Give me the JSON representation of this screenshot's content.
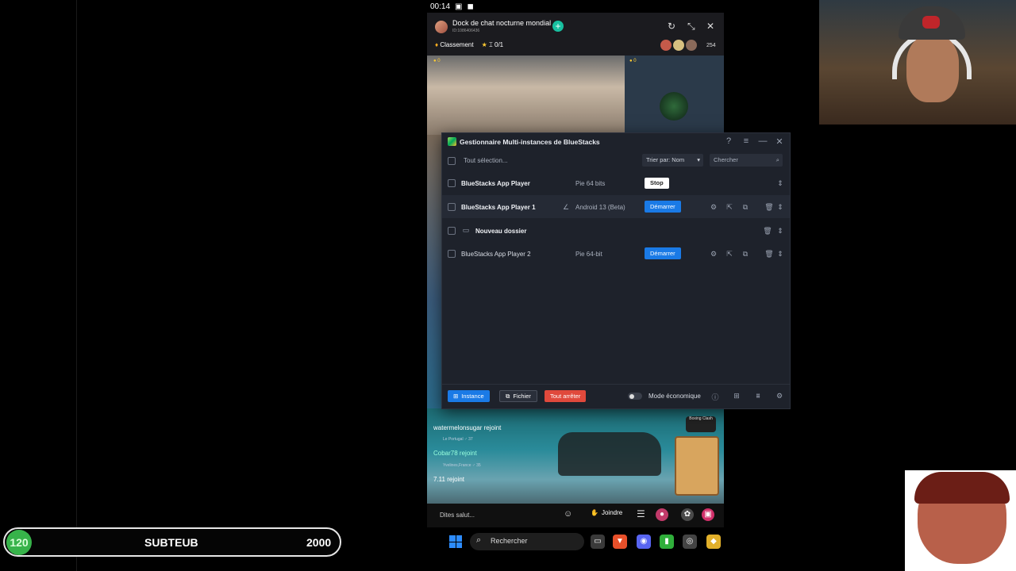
{
  "phone": {
    "time": "00:14",
    "room_title": "Dock de chat nocturne mondial",
    "room_id": "ID:1086406436",
    "plus": "+",
    "ranking_label": "Classement",
    "ranking_count": "0/1",
    "viewer_count": "254",
    "coin_left": "0",
    "coin_right": "0",
    "chat": [
      {
        "user": "watermelonsugar",
        "action": "rejoint",
        "location": "Le Portugal",
        "level": "37"
      },
      {
        "user": "Cobar78",
        "action": "rejoint",
        "location": "Yvelines,France",
        "level": "35"
      },
      {
        "user": "7.11",
        "action": "rejoint"
      }
    ],
    "game_badge": "Boxing Clash",
    "chat_placeholder": "Dites salut...",
    "join_label": "Joindre"
  },
  "mim": {
    "title": "Gestionnaire Multi-instances de BlueStacks",
    "select_all": "Tout sélection...",
    "sort_label": "Trier par: Nom",
    "search_placeholder": "Chercher",
    "rows": [
      {
        "name": "BlueStacks App Player",
        "version": "Pie 64 bits",
        "action": "Stop"
      },
      {
        "name": "BlueStacks App Player 1",
        "version": "Android 13 (Beta)",
        "action": "Démarrer"
      },
      {
        "name": "Nouveau dossier"
      },
      {
        "name": "BlueStacks App Player 2",
        "version": "Pie 64-bit",
        "action": "Démarrer"
      }
    ],
    "footer": {
      "instance": "Instance",
      "file": "Fichier",
      "stop_all": "Tout arrêter",
      "eco_mode": "Mode économique"
    }
  },
  "goal": {
    "current": "120",
    "label": "SUBTEUB",
    "target": "2000"
  },
  "taskbar": {
    "search_label": "Rechercher"
  },
  "colors": {
    "accent_blue": "#1a7ae6",
    "stop_red": "#e0493c",
    "goal_green": "#37b34a"
  }
}
